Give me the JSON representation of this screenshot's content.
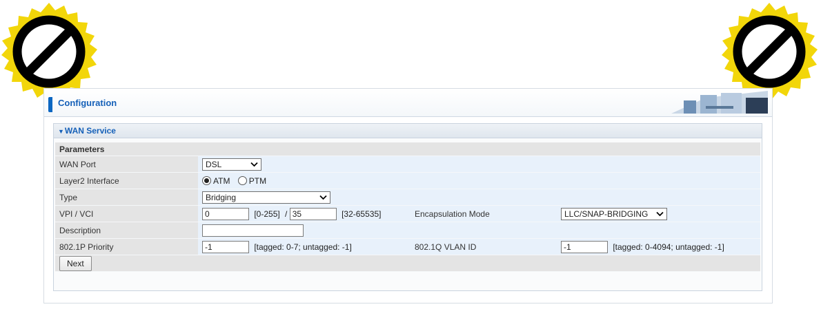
{
  "header": {
    "title": "Configuration"
  },
  "panel": {
    "title": "WAN Service",
    "section_label": "Parameters"
  },
  "fields": {
    "wan_port": {
      "label": "WAN Port",
      "value": "DSL"
    },
    "layer2": {
      "label": "Layer2 Interface",
      "options": [
        "ATM",
        "PTM"
      ],
      "selected": "ATM"
    },
    "type": {
      "label": "Type",
      "value": "Bridging"
    },
    "vpi_vci": {
      "label": "VPI / VCI",
      "vpi": "0",
      "vpi_range": "[0-255]",
      "separator": "/",
      "vci": "35",
      "vci_range": "[32-65535]"
    },
    "encapsulation": {
      "label": "Encapsulation Mode",
      "value": "LLC/SNAP-BRIDGING"
    },
    "description": {
      "label": "Description",
      "value": ""
    },
    "priority": {
      "label": "802.1P Priority",
      "value": "-1",
      "hint": "[tagged: 0-7; untagged: -1]"
    },
    "vlan": {
      "label": "802.1Q VLAN ID",
      "value": "-1",
      "hint": "[tagged: 0-4094; untagged: -1]"
    }
  },
  "actions": {
    "next_label": "Next"
  },
  "colors": {
    "accent": "#1560b8",
    "sticker_yellow": "#f2d60a"
  },
  "icons": [
    "prohibited-sticker-icon",
    "chevron-down-icon",
    "office-banner-image"
  ]
}
